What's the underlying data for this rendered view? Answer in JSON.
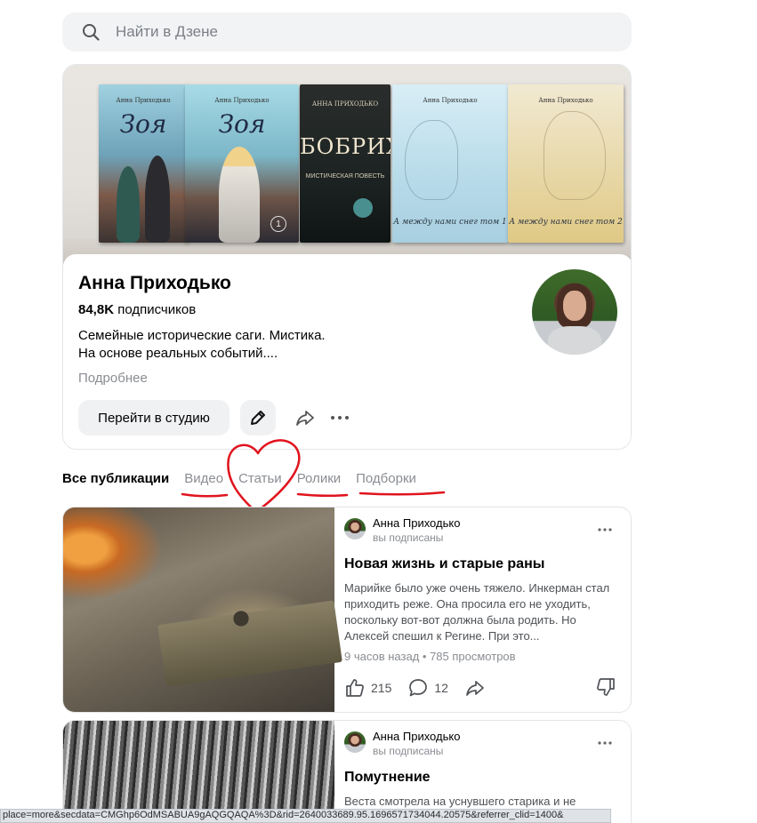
{
  "search": {
    "placeholder": "Найти в Дзене"
  },
  "cover": {
    "books": [
      {
        "title": "Зоя",
        "author": "Анна Приходько"
      },
      {
        "title": "Зоя",
        "author": "Анна Приходько",
        "volume": "1"
      },
      {
        "title": "БОБРИХА",
        "subtitle": "МИСТИЧЕСКАЯ ПОВЕСТЬ",
        "author": "АННА ПРИХОДЬКО"
      },
      {
        "title": "А между нами снег том 1",
        "author": "Анна Приходько"
      },
      {
        "title": "А между нами снег том 2",
        "author": "Анна Приходько"
      }
    ]
  },
  "channel": {
    "name": "Анна Приходько",
    "subscribers_count": "84,8K",
    "subscribers_label": "подписчиков",
    "description_line1": "Семейные исторические саги. Мистика.",
    "description_line2": "На основе реальных событий....",
    "more_label": "Подробнее",
    "studio_button": "Перейти в студию"
  },
  "tabs": [
    {
      "label": "Все публикации",
      "active": true
    },
    {
      "label": "Видео"
    },
    {
      "label": "Статьи"
    },
    {
      "label": "Ролики"
    },
    {
      "label": "Подборки"
    }
  ],
  "annotation_color": "#e0141e",
  "posts": [
    {
      "author": "Анна Приходько",
      "status": "вы подписаны",
      "title": "Новая жизнь и старые раны",
      "excerpt": "Марийке было уже очень тяжело. Инкерман стал приходить реже. Она просила его не уходить, поскольку вот-вот должна была родить. Но Алексей спешил к Регине. При это...",
      "time": "9 часов назад",
      "views": "785 просмотров",
      "likes": "215",
      "comments": "12"
    },
    {
      "author": "Анна Приходько",
      "status": "вы подписаны",
      "title": "Помутнение",
      "excerpt": "Веста смотрела на уснувшего старика и не"
    }
  ],
  "status_url": "place=more&secdata=CMGhp6OdMSABUA9gAQGQAQA%3D&rid=2640033689.95.1696571734044.20575&referrer_clid=1400&"
}
